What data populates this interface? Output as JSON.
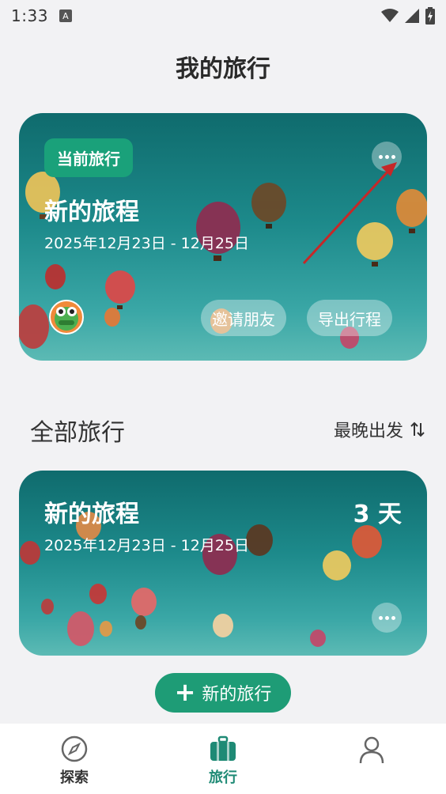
{
  "status": {
    "time": "1:33",
    "notification": "A"
  },
  "header": {
    "title": "我的旅行"
  },
  "current_trip": {
    "badge": "当前旅行",
    "title": "新的旅程",
    "dates": "2025年12月23日 - 12月25日",
    "invite_label": "邀请朋友",
    "export_label": "导出行程"
  },
  "all_trips": {
    "section_title": "全部旅行",
    "sort_label": "最晚出发",
    "items": [
      {
        "title": "新的旅程",
        "dates": "2025年12月23日 - 12月25日",
        "days": "3 天"
      }
    ]
  },
  "new_trip_button": {
    "label": "新的旅行"
  },
  "tabs": [
    {
      "label": "探索",
      "icon": "compass-icon",
      "active": false
    },
    {
      "label": "旅行",
      "icon": "suitcase-icon",
      "active": true
    },
    {
      "label": "",
      "icon": "profile-icon",
      "active": false
    }
  ],
  "colors": {
    "accent": "#1e9c76",
    "card_top": "#0f6b6d",
    "card_bottom": "#5cbab4",
    "arrow": "#c62828"
  }
}
